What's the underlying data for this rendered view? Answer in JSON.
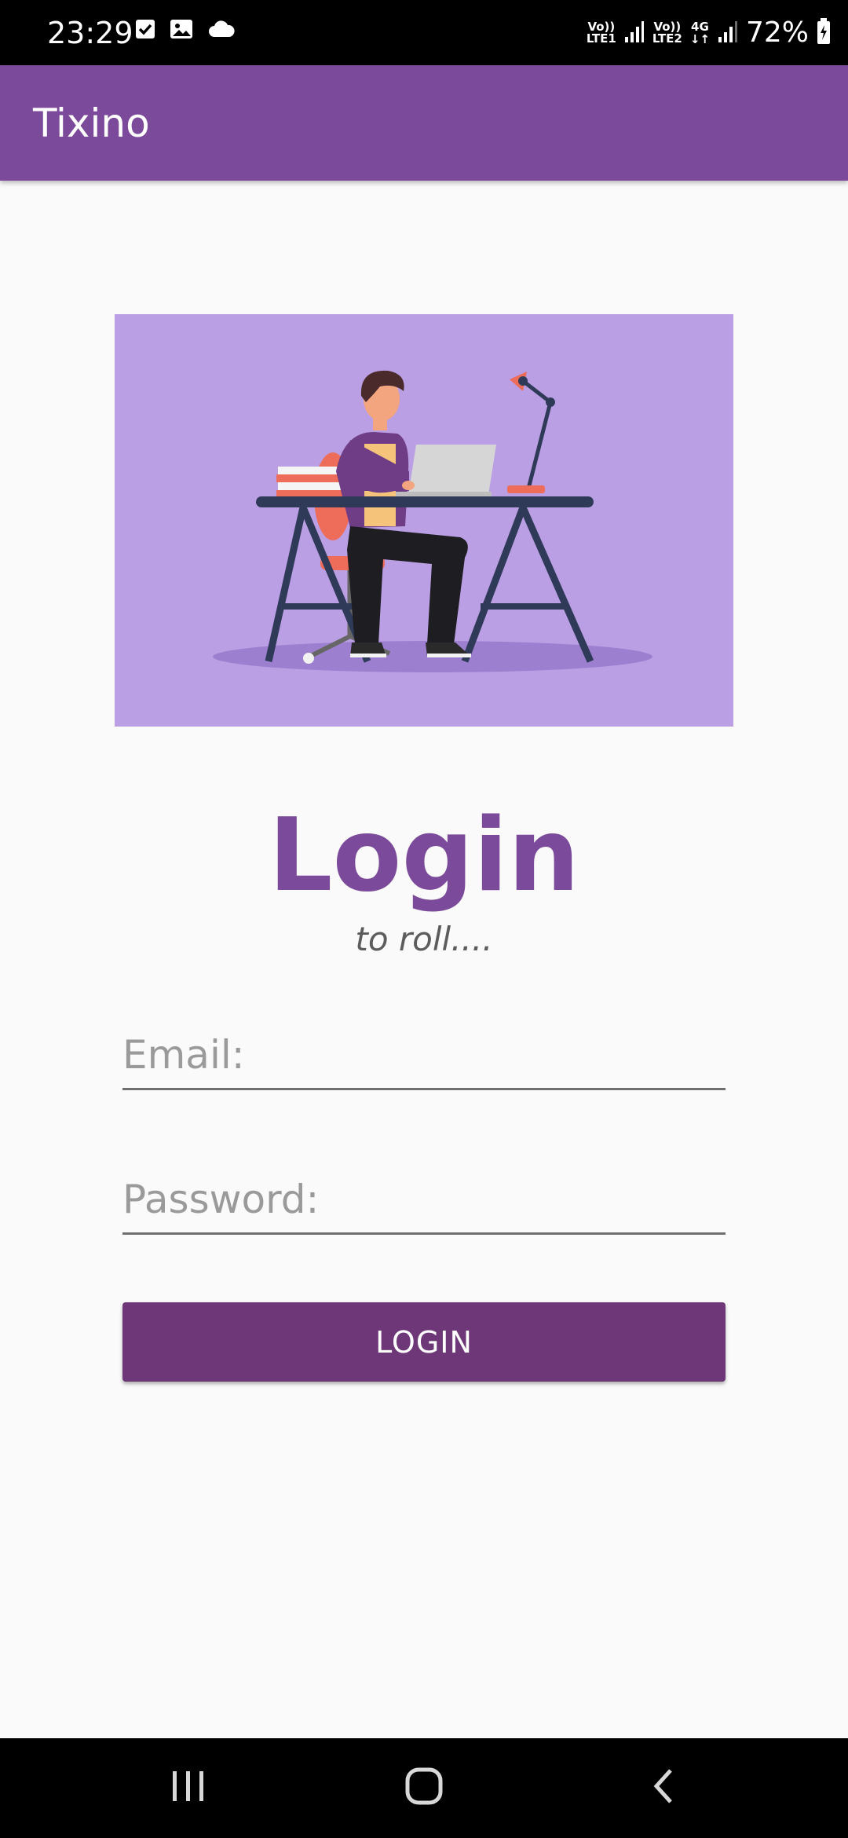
{
  "status_bar": {
    "time": "23:29",
    "net1_top": "Vo))",
    "net1_bottom": "LTE1",
    "net2_top": "Vo))",
    "net2_bottom": "LTE2",
    "net3_top": "4G",
    "net3_bottom": "↓↑",
    "battery": "72%",
    "icons": [
      "checkbox-icon",
      "image-icon",
      "cloud-icon",
      "signal-icon",
      "battery-icon"
    ]
  },
  "app_bar": {
    "title": "Tixino"
  },
  "hero": {
    "image": "person-at-desk-illustration",
    "background_color": "#bb9fe4"
  },
  "login": {
    "title": "Login",
    "subtitle": "to roll....",
    "email_placeholder": "Email:",
    "email_value": "",
    "password_placeholder": "Password:",
    "password_value": "",
    "button_label": "LOGIN"
  },
  "colors": {
    "primary": "#7b4a9a",
    "button": "#6e3878",
    "background": "#fafafa"
  },
  "nav_bar": {
    "icons": [
      "recents-icon",
      "home-icon",
      "back-icon"
    ]
  }
}
